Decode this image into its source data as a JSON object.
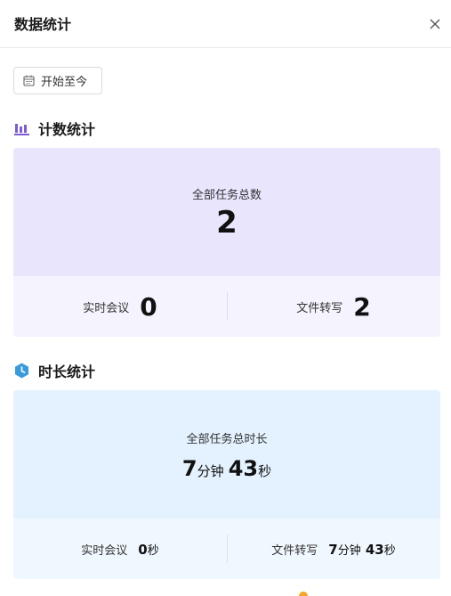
{
  "header": {
    "title": "数据统计"
  },
  "date_filter": {
    "label": "开始至今"
  },
  "count_section": {
    "title": "计数统计",
    "total_label": "全部任务总数",
    "total_value": "2",
    "realtime_label": "实时会议",
    "realtime_value": "0",
    "transcribe_label": "文件转写",
    "transcribe_value": "2"
  },
  "duration_section": {
    "title": "时长统计",
    "total_label": "全部任务总时长",
    "total_minutes": "7",
    "total_min_unit": "分钟",
    "total_seconds": "43",
    "total_sec_unit": "秒",
    "realtime_label": "实时会议",
    "realtime_seconds": "0",
    "realtime_sec_unit": "秒",
    "transcribe_label": "文件转写",
    "transcribe_minutes": "7",
    "transcribe_min_unit": "分钟",
    "transcribe_seconds": "43",
    "transcribe_sec_unit": "秒"
  },
  "colors": {
    "count_accent": "#7b5cd6",
    "duration_accent": "#3a9bdc",
    "count_card_top": "#e8e5fd",
    "count_card_bottom": "#f4f3fe",
    "duration_card_top": "#e3f2fe",
    "duration_card_bottom": "#f0f8ff"
  },
  "icons": {
    "close": "close-icon",
    "calendar": "calendar-icon",
    "count": "bar-chart-icon",
    "duration": "clock-icon"
  }
}
